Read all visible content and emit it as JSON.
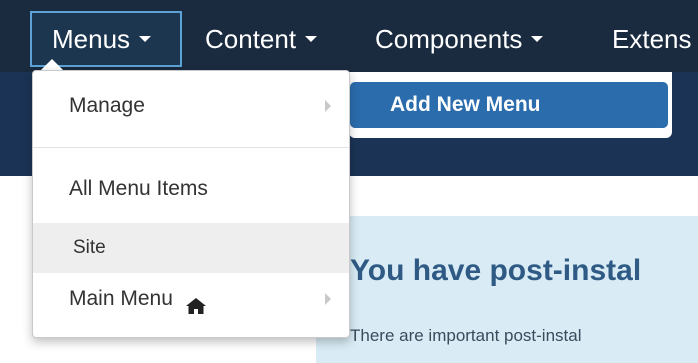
{
  "navbar": {
    "items": [
      {
        "label": "Menus",
        "active": true
      },
      {
        "label": "Content"
      },
      {
        "label": "Components"
      },
      {
        "label": "Extens"
      }
    ]
  },
  "dropdown": {
    "items": [
      {
        "label": "Manage",
        "has_submenu": true
      },
      {
        "label": "All Menu Items"
      },
      {
        "label": "Site",
        "is_header": true
      },
      {
        "label": "Main Menu",
        "icon": "home-icon",
        "has_submenu": true
      }
    ]
  },
  "submenu": {
    "items": [
      {
        "label": "Add New Menu"
      }
    ]
  },
  "notice": {
    "title": "You have post-instal",
    "text": "There are important post-instal"
  },
  "colors": {
    "navbar_bg": "#1a2a3f",
    "subheader_bg": "#1b3455",
    "submenu_item_bg": "#2b6cad",
    "notice_bg": "#d9ecf6"
  }
}
